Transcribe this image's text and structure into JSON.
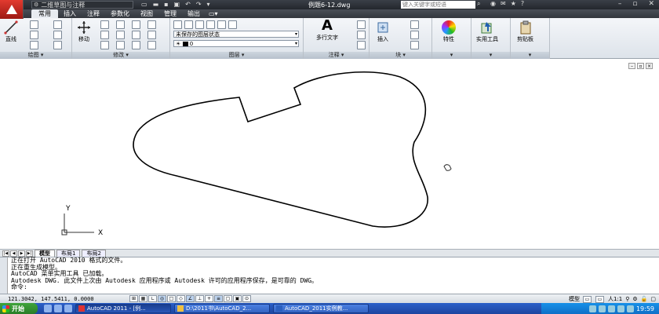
{
  "titlebar": {
    "workspace": "二维草图与注释",
    "document_title": "例题6-12.dwg",
    "search_placeholder": "键入关键字或短语"
  },
  "ribbon": {
    "tabs": [
      "常用",
      "插入",
      "注释",
      "参数化",
      "视图",
      "管理",
      "输出"
    ],
    "active_tab": "常用",
    "panels": {
      "draw": {
        "label": "绘图",
        "line_label": "直线"
      },
      "modify": {
        "label": "修改",
        "move_label": "移动"
      },
      "layers": {
        "label": "图层",
        "layer_state": "未保存的图层状态",
        "current_layer": "0"
      },
      "annotation": {
        "label": "注释",
        "mtext_label": "多行文字"
      },
      "block": {
        "label": "块",
        "insert_label": "插入"
      },
      "properties": {
        "label": "特性"
      },
      "utilities": {
        "label": "实用工具"
      },
      "clipboard": {
        "label": "剪贴板"
      }
    }
  },
  "drawing": {
    "ucs_y": "Y",
    "ucs_x": "X"
  },
  "layout_tabs": [
    "模型",
    "布局1",
    "布局2"
  ],
  "command_window": {
    "lines": [
      "正在打开 AutoCAD 2010 格式的文件。",
      "正在重生成模型。",
      "AutoCAD 菜单实用工具 已加载。",
      "Autodesk DWG.   此文件上次由 Autodesk 应用程序或 Autodesk 许可的应用程序保存，是可靠的 DWG。"
    ],
    "prompt": "命令:"
  },
  "statusbar": {
    "coords": "121.3042, 147.5411, 0.0000",
    "model_label": "模型",
    "annotation_scale": "人1:1"
  },
  "taskbar": {
    "start_label": "开始",
    "tasks": [
      "AutoCAD 2011 - [例...",
      "D:\\2011书\\AutoCAD_2...",
      "AutoCAD_2011实例教..."
    ],
    "clock": "19:59"
  },
  "colors": {
    "titlebar": "#2b2f35",
    "ribbon": "#e6ebf0",
    "taskbar": "#2458be"
  }
}
